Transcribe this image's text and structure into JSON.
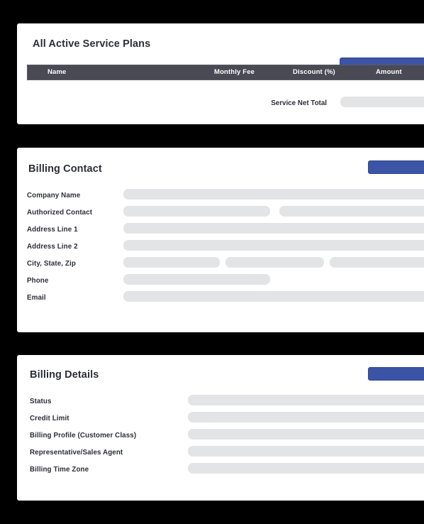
{
  "theme": {
    "page_background": "#000000",
    "card_background": "#ffffff",
    "accent_blue": "#3c54a5",
    "table_header_background": "#4a4a55",
    "skeleton_gray": "#e3e4e6",
    "text_color": "#2b2f38"
  },
  "cards": [
    {
      "id": "service-plans",
      "title": "All Active Service Plans",
      "action_button": {
        "label": "",
        "name": "add-service-plan-button"
      },
      "table": {
        "columns": [
          "Name",
          "Monthly Fee",
          "Discount (%)",
          "Amount"
        ],
        "rows": [],
        "footer": {
          "label": "Service Net Total",
          "value": ""
        }
      }
    },
    {
      "id": "billing-contact",
      "title": "Billing Contact",
      "action_button": {
        "label": "",
        "name": "edit-billing-contact-button"
      },
      "fields": [
        {
          "label": "Company Name",
          "name": "company-name",
          "inputs": 1
        },
        {
          "label": "Authorized Contact",
          "name": "authorized-contact",
          "inputs": 2
        },
        {
          "label": "Address Line 1",
          "name": "address-line-1",
          "inputs": 1
        },
        {
          "label": "Address Line 2",
          "name": "address-line-2",
          "inputs": 1
        },
        {
          "label": "City, State, Zip",
          "name": "city-state-zip",
          "inputs": 3
        },
        {
          "label": "Phone",
          "name": "phone",
          "inputs": 1
        },
        {
          "label": "Email",
          "name": "email",
          "inputs": 1
        }
      ]
    },
    {
      "id": "billing-details",
      "title": "Billing Details",
      "action_button": {
        "label": "",
        "name": "edit-billing-details-button"
      },
      "fields": [
        {
          "label": "Status",
          "name": "status"
        },
        {
          "label": "Credit Limit",
          "name": "credit-limit"
        },
        {
          "label": "Billing Profile (Customer Class)",
          "name": "billing-profile"
        },
        {
          "label": "Representative/Sales Agent",
          "name": "representative-sales-agent"
        },
        {
          "label": "Billing Time Zone",
          "name": "billing-time-zone"
        }
      ]
    }
  ]
}
